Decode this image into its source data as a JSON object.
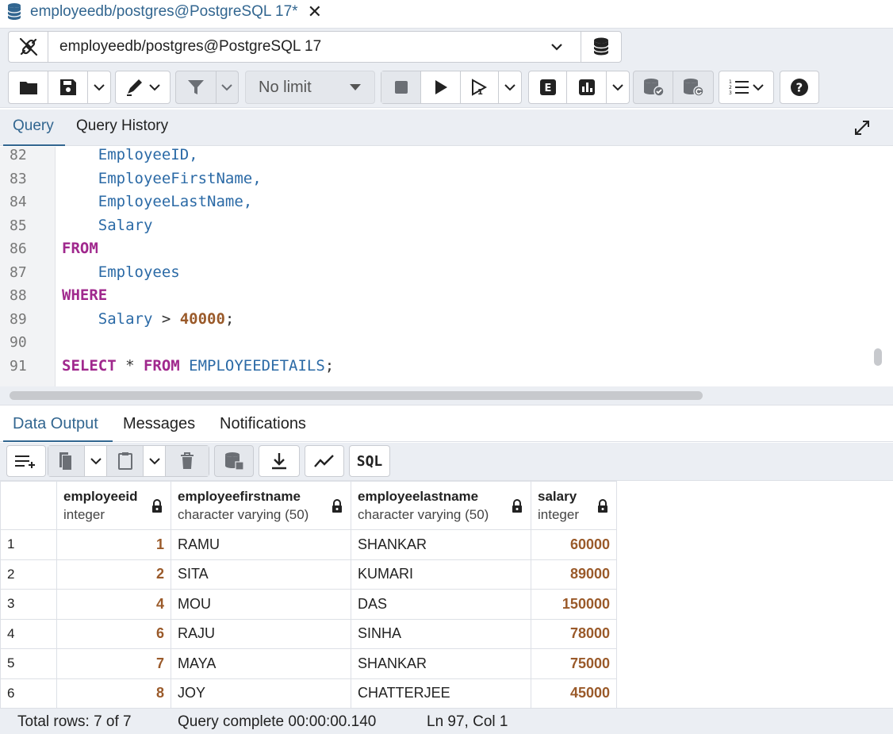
{
  "tab": {
    "title": "employeedb/postgres@PostgreSQL 17*",
    "close": "✕"
  },
  "connection": {
    "label": "employeedb/postgres@PostgreSQL 17"
  },
  "toolbar": {
    "limit_value": "No limit"
  },
  "query_tabs": [
    "Query",
    "Query History"
  ],
  "editor": {
    "lines": [
      {
        "n": "82",
        "tokens": [
          {
            "t": "    EmployeeID,",
            "c": "id"
          }
        ]
      },
      {
        "n": "83",
        "tokens": [
          {
            "t": "    EmployeeFirstName,",
            "c": "id"
          }
        ]
      },
      {
        "n": "84",
        "tokens": [
          {
            "t": "    EmployeeLastName,",
            "c": "id"
          }
        ]
      },
      {
        "n": "85",
        "tokens": [
          {
            "t": "    Salary",
            "c": "id"
          }
        ]
      },
      {
        "n": "86",
        "tokens": [
          {
            "t": "FROM",
            "c": "kw"
          }
        ]
      },
      {
        "n": "87",
        "tokens": [
          {
            "t": "    Employees",
            "c": "id"
          }
        ]
      },
      {
        "n": "88",
        "tokens": [
          {
            "t": "WHERE",
            "c": "kw"
          }
        ]
      },
      {
        "n": "89",
        "tokens": [
          {
            "t": "    Salary",
            "c": "id"
          },
          {
            "t": " > ",
            "c": "op"
          },
          {
            "t": "40000",
            "c": "num"
          },
          {
            "t": ";",
            "c": "op"
          }
        ]
      },
      {
        "n": "90",
        "tokens": []
      },
      {
        "n": "91",
        "tokens": [
          {
            "t": "SELECT",
            "c": "kw"
          },
          {
            "t": " * ",
            "c": "op"
          },
          {
            "t": "FROM",
            "c": "kw"
          },
          {
            "t": " EMPLOYEEDETAILS",
            "c": "id"
          },
          {
            "t": ";",
            "c": "op"
          }
        ]
      }
    ]
  },
  "result_tabs": [
    "Data Output",
    "Messages",
    "Notifications"
  ],
  "result_toolbar": {
    "sql_label": "SQL"
  },
  "grid": {
    "columns": [
      {
        "name": "employeeid",
        "type": "integer"
      },
      {
        "name": "employeefirstname",
        "type": "character varying (50)"
      },
      {
        "name": "employeelastname",
        "type": "character varying (50)"
      },
      {
        "name": "salary",
        "type": "integer"
      }
    ],
    "rows": [
      {
        "rn": "1",
        "cells": [
          "1",
          "RAMU",
          "SHANKAR",
          "60000"
        ]
      },
      {
        "rn": "2",
        "cells": [
          "2",
          "SITA",
          "KUMARI",
          "89000"
        ]
      },
      {
        "rn": "3",
        "cells": [
          "4",
          "MOU",
          "DAS",
          "150000"
        ]
      },
      {
        "rn": "4",
        "cells": [
          "6",
          "RAJU",
          "SINHA",
          "78000"
        ]
      },
      {
        "rn": "5",
        "cells": [
          "7",
          "MAYA",
          "SHANKAR",
          "75000"
        ]
      },
      {
        "rn": "6",
        "cells": [
          "8",
          "JOY",
          "CHATTERJEE",
          "45000"
        ]
      }
    ]
  },
  "status": {
    "total_rows": "Total rows: 7 of 7",
    "query_time": "Query complete 00:00:00.140",
    "cursor": "Ln 97, Col 1"
  },
  "colors": {
    "accent": "#326690",
    "keyword": "#a0288d",
    "identifier": "#2b6aa6",
    "number": "#9a5a2a"
  }
}
